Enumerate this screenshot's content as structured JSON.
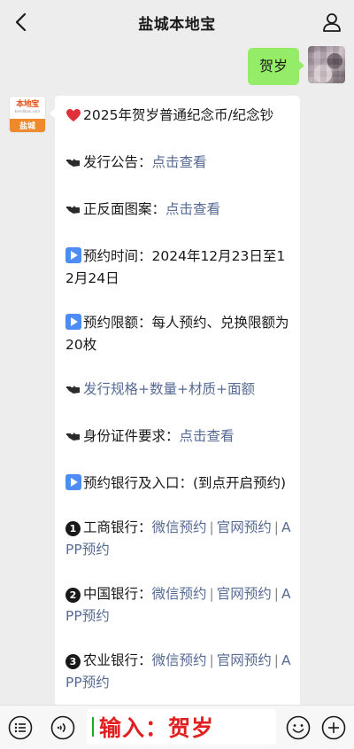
{
  "header": {
    "title": "盐城本地宝",
    "back_icon": "chevron-left-icon",
    "user_icon": "person-icon"
  },
  "outgoing": {
    "text": "贺岁"
  },
  "incoming_avatar": {
    "brand": "本地宝",
    "domain": "bendibao.com",
    "city": "盐城"
  },
  "message": {
    "title": "2025年贺岁普通纪念币/纪念钞",
    "announce_label": "发行公告：",
    "announce_link": "点击查看",
    "pattern_label": "正反面图案：",
    "pattern_link": "点击查看",
    "time_text": "预约时间：2024年12月23日至12月24日",
    "limit_text": "预约限额：每人预约、兑换限额为20枚",
    "spec_link": "发行规格+数量+材质+面额",
    "id_label": "身份证件要求：",
    "id_link": "点击查看",
    "bank_text": "预约银行及入口：(到点开启预约)",
    "banks": [
      {
        "num": "❶",
        "name": "工商银行：",
        "wechat": "微信预约",
        "site": "官网预约",
        "app": "APP预约"
      },
      {
        "num": "❷",
        "name": "中国银行：",
        "wechat": "微信预约",
        "site": "官网预约",
        "app": "APP预约"
      },
      {
        "num": "❸",
        "name": "农业银行：",
        "wechat": "微信预约",
        "site": "官网预约",
        "app": "APP预约"
      }
    ],
    "separator": "|"
  },
  "input_bar": {
    "value": "输入：贺岁",
    "menu_icon": "menu-list-icon",
    "voice_icon": "voice-icon",
    "emoji_icon": "emoji-icon",
    "plus_icon": "plus-icon"
  },
  "colors": {
    "link": "#576b95",
    "bubble_out": "#95ec69",
    "input_text": "#e02020"
  }
}
